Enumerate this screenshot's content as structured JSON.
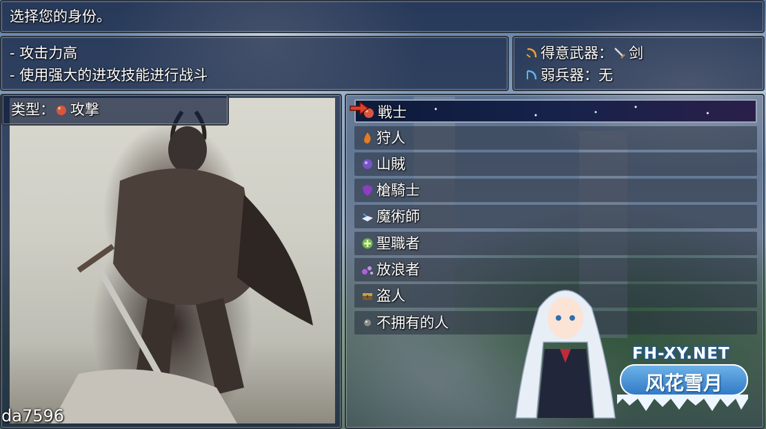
{
  "prompt": {
    "text": "选择您的身份。"
  },
  "description": {
    "lines": [
      "- 攻击力高",
      "- 使用强大的进攻技能进行战斗"
    ]
  },
  "weapons": {
    "favored_label": "得意武器：",
    "favored_value": "剑",
    "weak_label": "弱兵器：",
    "weak_value": "无"
  },
  "type": {
    "label": "类型：",
    "value": "攻撃"
  },
  "classes": [
    {
      "name": "戦士",
      "icon": "fist-icon",
      "color": "#d8553f",
      "selected": true
    },
    {
      "name": "狩人",
      "icon": "flame-icon",
      "color": "#e57a22"
    },
    {
      "name": "山賊",
      "icon": "purple-orb-icon",
      "color": "#7a52c8"
    },
    {
      "name": "槍騎士",
      "icon": "shield-icon",
      "color": "#8a3fc0"
    },
    {
      "name": "魔術師",
      "icon": "book-icon",
      "color": "#5c9fe0"
    },
    {
      "name": "聖職者",
      "icon": "cross-orb-icon",
      "color": "#6dbb4f"
    },
    {
      "name": "放浪者",
      "icon": "bubbles-icon",
      "color": "#b15fe0"
    },
    {
      "name": "盗人",
      "icon": "chest-icon",
      "color": "#c9a04a"
    },
    {
      "name": "不拥有的人",
      "icon": "gray-orb-icon",
      "color": "#8a8a8a"
    }
  ],
  "watermark": {
    "site": "FH-XY.NET",
    "brand": "风花雪月",
    "user": "da7596"
  }
}
